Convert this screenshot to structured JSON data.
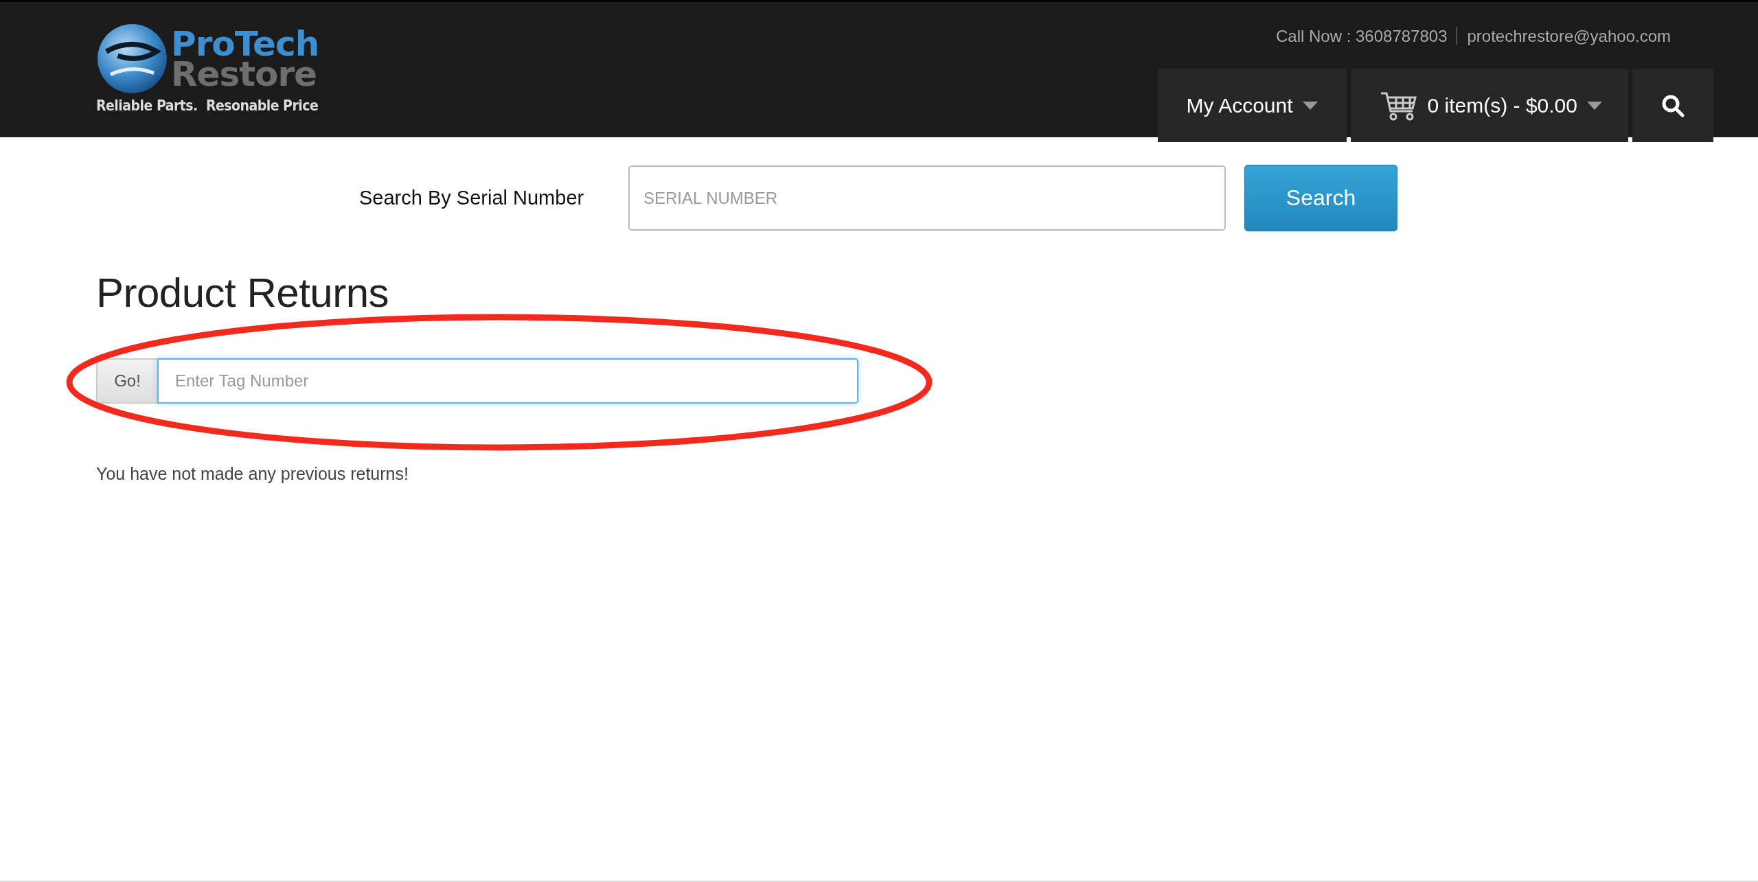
{
  "header": {
    "logo": {
      "line_1": "ProTech",
      "line_2": "Restore",
      "tagline": "Reliable Parts.  Resonable Price"
    },
    "contact": {
      "phone": "Call Now : 3608787803",
      "email": "protechrestore@yahoo.com"
    },
    "account_menu": {
      "label": "My Account"
    },
    "cart": {
      "label": "0 item(s) - $0.00"
    }
  },
  "serial_search": {
    "label": "Search By Serial Number",
    "placeholder": "SERIAL NUMBER",
    "button": "Search"
  },
  "returns": {
    "title": "Product Returns",
    "go_button": "Go!",
    "placeholder": "Enter Tag Number",
    "message": "You have not made any previous returns!"
  }
}
